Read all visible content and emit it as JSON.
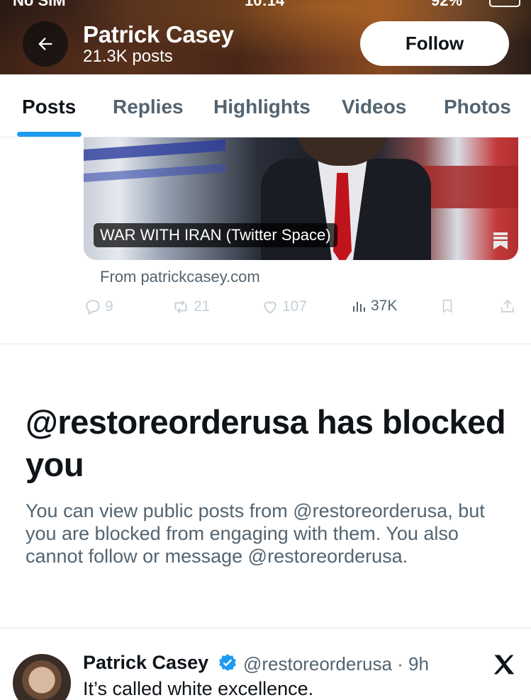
{
  "status_bar": {
    "carrier": "No SIM",
    "time": "10:14",
    "battery": "92%"
  },
  "header": {
    "name": "Patrick Casey",
    "post_count": "21.3K posts",
    "follow_label": "Follow"
  },
  "tabs": [
    {
      "label": "Posts",
      "active": true
    },
    {
      "label": "Replies",
      "active": false
    },
    {
      "label": "Highlights",
      "active": false
    },
    {
      "label": "Videos",
      "active": false
    },
    {
      "label": "Photos",
      "active": false
    }
  ],
  "media_post": {
    "card_label": "WAR WITH IRAN (Twitter Space)",
    "source": "From patrickcasey.com",
    "replies": "9",
    "reposts": "21",
    "likes": "107",
    "views": "37K"
  },
  "blocked_notice": {
    "title": "@restoreorderusa has blocked you",
    "description": "You can view public posts from @restoreorderusa, but you are blocked from engaging with them. You also cannot follow or message @restoreorderusa."
  },
  "next_post": {
    "name": "Patrick Casey",
    "handle": "@restoreorderusa",
    "time": "9h",
    "handle_time": "@restoreorderusa · 9h",
    "text": "It’s called white excellence."
  },
  "colors": {
    "accent": "#1d9bf0",
    "text": "#0f1419",
    "muted": "#536471"
  },
  "icons": [
    "back-arrow-icon",
    "reply-icon",
    "repost-icon",
    "like-icon",
    "views-icon",
    "bookmark-icon",
    "share-icon",
    "verified-badge-icon",
    "x-logo-icon"
  ]
}
